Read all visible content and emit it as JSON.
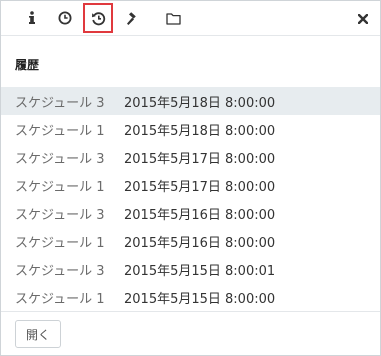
{
  "toolbar": {
    "icons": [
      "info-icon",
      "clock-icon",
      "history-icon",
      "hammer-icon",
      "folder-icon"
    ],
    "active_icon": "history-icon",
    "active_color": "#e0393e",
    "close_icon": "close-icon"
  },
  "section": {
    "title": "履歴"
  },
  "history": {
    "selected_index": 0,
    "selected_color": "#e7ecef",
    "rows": [
      {
        "name": "スケジュール 3",
        "date": "2015年5月18日 8:00:00"
      },
      {
        "name": "スケジュール 1",
        "date": "2015年5月18日 8:00:00"
      },
      {
        "name": "スケジュール 3",
        "date": "2015年5月17日 8:00:00"
      },
      {
        "name": "スケジュール 1",
        "date": "2015年5月17日 8:00:00"
      },
      {
        "name": "スケジュール 3",
        "date": "2015年5月16日 8:00:00"
      },
      {
        "name": "スケジュール 1",
        "date": "2015年5月16日 8:00:00"
      },
      {
        "name": "スケジュール 3",
        "date": "2015年5月15日 8:00:01"
      },
      {
        "name": "スケジュール 1",
        "date": "2015年5月15日 8:00:00"
      }
    ]
  },
  "footer": {
    "open_label": "開く"
  }
}
